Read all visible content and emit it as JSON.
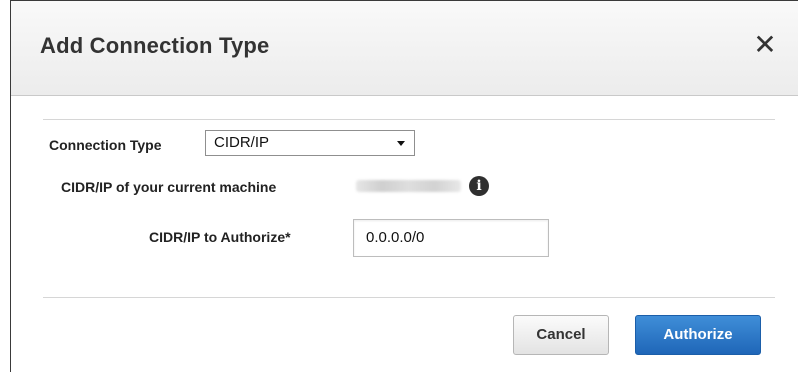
{
  "dialog": {
    "title": "Add Connection Type",
    "close_symbol": "✕"
  },
  "form": {
    "connection_type_label": "Connection Type",
    "connection_type_value": "CIDR/IP",
    "current_machine_label": "CIDR/IP of your current machine",
    "info_icon_glyph": "i",
    "authorize_label": "CIDR/IP to Authorize*",
    "authorize_value": "0.0.0.0/0"
  },
  "buttons": {
    "cancel": "Cancel",
    "authorize": "Authorize"
  },
  "icons": {
    "close": "close-icon",
    "info": "info-icon",
    "dropdown": "chevron-down-icon"
  },
  "colors": {
    "primary_button": "#2a74c6",
    "header_bg": "#f3f3f3"
  }
}
